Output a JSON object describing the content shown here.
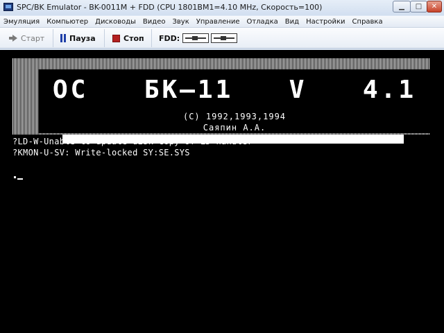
{
  "window": {
    "title": "SPC/BK Emulator - BK-0011M + FDD (CPU 1801BM1=4.10 MHz, Скорость=100)",
    "minimize_glyph": "▁",
    "maximize_glyph": "□",
    "close_glyph": "✕"
  },
  "menu": [
    {
      "label": "Эмуляция"
    },
    {
      "label": "Компьютер"
    },
    {
      "label": "Дисководы"
    },
    {
      "label": "Видео"
    },
    {
      "label": "Звук"
    },
    {
      "label": "Управление"
    },
    {
      "label": "Отладка"
    },
    {
      "label": "Вид"
    },
    {
      "label": "Настройки"
    },
    {
      "label": "Справка"
    }
  ],
  "toolbar": {
    "start_label": "Старт",
    "pause_label": "Пауза",
    "stop_label": "Стоп",
    "fdd_label": "FDD:",
    "start_color": "#7a7a7a",
    "pause_color": "#1f3fa8",
    "stop_color": "#b32020"
  },
  "screen": {
    "banner": {
      "title_parts": [
        "ОС",
        "БК—11",
        "V",
        "4.1"
      ],
      "copyright": "(C) 1992,1993,1994",
      "author": "Саяпин А.А."
    },
    "lines": [
      "?LD-W-Unable to update disk copy of LD handler",
      "?KMON-U-SV: Write-locked SY:SE.SYS"
    ],
    "prompt": "."
  }
}
